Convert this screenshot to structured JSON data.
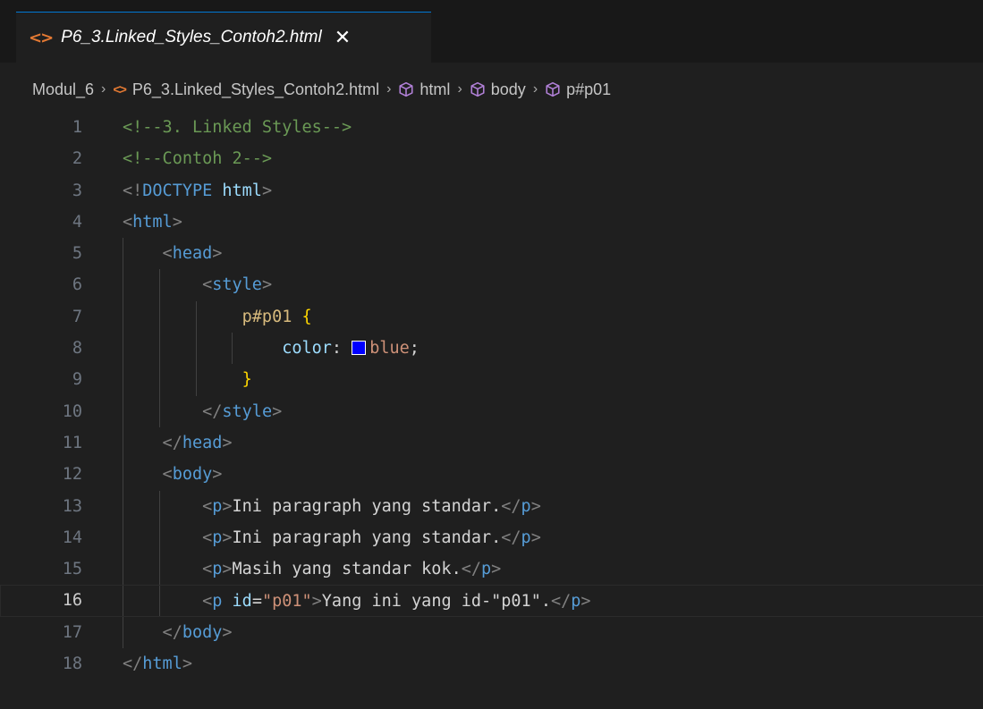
{
  "tab": {
    "icon": "<>",
    "filename": "P6_3.Linked_Styles_Contoh2.html",
    "close": "✕"
  },
  "breadcrumb": {
    "folder": "Modul_6",
    "file": "P6_3.Linked_Styles_Contoh2.html",
    "html": "html",
    "body": "body",
    "element": "p#p01",
    "separator": "›"
  },
  "editor": {
    "current_line": 16,
    "swatch_color": "#0000ff",
    "lines": [
      {
        "n": "1",
        "tokens": [
          [
            "cmt",
            "<!--3. Linked Styles-->"
          ]
        ]
      },
      {
        "n": "2",
        "tokens": [
          [
            "cmt",
            "<!--Contoh 2-->"
          ]
        ]
      },
      {
        "n": "3",
        "tokens": [
          [
            "br",
            "<!"
          ],
          [
            "dt",
            "DOCTYPE "
          ],
          [
            "attr",
            "html"
          ],
          [
            "br",
            ">"
          ]
        ]
      },
      {
        "n": "4",
        "tokens": [
          [
            "br",
            "<"
          ],
          [
            "tag",
            "html"
          ],
          [
            "br",
            ">"
          ]
        ]
      },
      {
        "n": "5",
        "tokens": [
          [
            "br",
            "    <"
          ],
          [
            "tag",
            "head"
          ],
          [
            "br",
            ">"
          ]
        ]
      },
      {
        "n": "6",
        "tokens": [
          [
            "br",
            "        <"
          ],
          [
            "tag",
            "style"
          ],
          [
            "br",
            ">"
          ]
        ]
      },
      {
        "n": "7",
        "tokens": [
          [
            "sel",
            "            p#p01 "
          ],
          [
            "brace",
            "{"
          ]
        ]
      },
      {
        "n": "8",
        "tokens": [
          [
            "prop",
            "                color"
          ],
          [
            "txt",
            ": "
          ],
          [
            "swatch",
            ""
          ],
          [
            "str",
            "blue"
          ],
          [
            "txt",
            ";"
          ]
        ]
      },
      {
        "n": "9",
        "tokens": [
          [
            "brace",
            "            }"
          ]
        ]
      },
      {
        "n": "10",
        "tokens": [
          [
            "br",
            "        </"
          ],
          [
            "tag",
            "style"
          ],
          [
            "br",
            ">"
          ]
        ]
      },
      {
        "n": "11",
        "tokens": [
          [
            "br",
            "    </"
          ],
          [
            "tag",
            "head"
          ],
          [
            "br",
            ">"
          ]
        ]
      },
      {
        "n": "12",
        "tokens": [
          [
            "br",
            "    <"
          ],
          [
            "tag",
            "body"
          ],
          [
            "br",
            ">"
          ]
        ]
      },
      {
        "n": "13",
        "tokens": [
          [
            "br",
            "        <"
          ],
          [
            "tag",
            "p"
          ],
          [
            "br",
            ">"
          ],
          [
            "txt",
            "Ini paragraph yang standar."
          ],
          [
            "br",
            "</"
          ],
          [
            "tag",
            "p"
          ],
          [
            "br",
            ">"
          ]
        ]
      },
      {
        "n": "14",
        "tokens": [
          [
            "br",
            "        <"
          ],
          [
            "tag",
            "p"
          ],
          [
            "br",
            ">"
          ],
          [
            "txt",
            "Ini paragraph yang standar."
          ],
          [
            "br",
            "</"
          ],
          [
            "tag",
            "p"
          ],
          [
            "br",
            ">"
          ]
        ]
      },
      {
        "n": "15",
        "tokens": [
          [
            "br",
            "        <"
          ],
          [
            "tag",
            "p"
          ],
          [
            "br",
            ">"
          ],
          [
            "txt",
            "Masih yang standar kok."
          ],
          [
            "br",
            "</"
          ],
          [
            "tag",
            "p"
          ],
          [
            "br",
            ">"
          ]
        ]
      },
      {
        "n": "16",
        "tokens": [
          [
            "br",
            "        <"
          ],
          [
            "tag",
            "p "
          ],
          [
            "attr",
            "id"
          ],
          [
            "txt",
            "="
          ],
          [
            "str",
            "\"p01\""
          ],
          [
            "br",
            ">"
          ],
          [
            "txt",
            "Yang ini yang id-\"p01\"."
          ],
          [
            "br",
            "</"
          ],
          [
            "tag",
            "p"
          ],
          [
            "br",
            ">"
          ]
        ]
      },
      {
        "n": "17",
        "tokens": [
          [
            "br",
            "    </"
          ],
          [
            "tag",
            "body"
          ],
          [
            "br",
            ">"
          ]
        ]
      },
      {
        "n": "18",
        "tokens": [
          [
            "br",
            "</"
          ],
          [
            "tag",
            "html"
          ],
          [
            "br",
            ">"
          ]
        ]
      }
    ]
  }
}
